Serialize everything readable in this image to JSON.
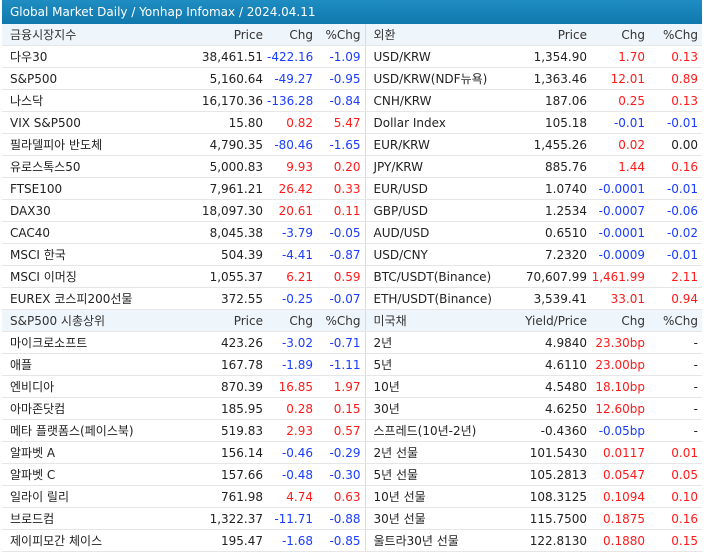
{
  "title": "Global Market Daily / Yonhap Infomax / 2024.04.11",
  "colors": {
    "up": "#ff1a1a",
    "down": "#1a3cff",
    "header_bg": "#1e88c0"
  },
  "section1": {
    "left_header": [
      "금융시장지수",
      "Price",
      "Chg",
      "%Chg"
    ],
    "right_header": [
      "외환",
      "Price",
      "Chg",
      "%Chg"
    ],
    "rows": [
      {
        "l": [
          "다우30",
          "38,461.51",
          "-422.16",
          "-1.09"
        ],
        "lc": "down",
        "r": [
          "USD/KRW",
          "1,354.90",
          "1.70",
          "0.13"
        ],
        "rc": "up"
      },
      {
        "l": [
          "S&P500",
          "5,160.64",
          "-49.27",
          "-0.95"
        ],
        "lc": "down",
        "r": [
          "USD/KRW(NDF뉴욕)",
          "1,363.46",
          "12.01",
          "0.89"
        ],
        "rc": "up"
      },
      {
        "l": [
          "나스닥",
          "16,170.36",
          "-136.28",
          "-0.84"
        ],
        "lc": "down",
        "r": [
          "CNH/KRW",
          "187.06",
          "0.25",
          "0.13"
        ],
        "rc": "up"
      },
      {
        "l": [
          "VIX S&P500",
          "15.80",
          "0.82",
          "5.47"
        ],
        "lc": "up",
        "r": [
          "Dollar Index",
          "105.18",
          "-0.01",
          "-0.01"
        ],
        "rc": "down"
      },
      {
        "l": [
          "필라델피아 반도체",
          "4,790.35",
          "-80.46",
          "-1.65"
        ],
        "lc": "down",
        "r": [
          "EUR/KRW",
          "1,455.26",
          "0.02",
          "0.00"
        ],
        "rc": "upzero"
      },
      {
        "l": [
          "유로스톡스50",
          "5,000.83",
          "9.93",
          "0.20"
        ],
        "lc": "up",
        "r": [
          "JPY/KRW",
          "885.76",
          "1.44",
          "0.16"
        ],
        "rc": "up"
      },
      {
        "l": [
          "FTSE100",
          "7,961.21",
          "26.42",
          "0.33"
        ],
        "lc": "up",
        "r": [
          "EUR/USD",
          "1.0740",
          "-0.0001",
          "-0.01"
        ],
        "rc": "down"
      },
      {
        "l": [
          "DAX30",
          "18,097.30",
          "20.61",
          "0.11"
        ],
        "lc": "up",
        "r": [
          "GBP/USD",
          "1.2534",
          "-0.0007",
          "-0.06"
        ],
        "rc": "down"
      },
      {
        "l": [
          "CAC40",
          "8,045.38",
          "-3.79",
          "-0.05"
        ],
        "lc": "down",
        "r": [
          "AUD/USD",
          "0.6510",
          "-0.0001",
          "-0.02"
        ],
        "rc": "down"
      },
      {
        "l": [
          "MSCI 한국",
          "504.39",
          "-4.41",
          "-0.87"
        ],
        "lc": "down",
        "r": [
          "USD/CNY",
          "7.2320",
          "-0.0009",
          "-0.01"
        ],
        "rc": "down"
      },
      {
        "l": [
          "MSCI 이머징",
          "1,055.37",
          "6.21",
          "0.59"
        ],
        "lc": "up",
        "r": [
          "BTC/USDT(Binance)",
          "70,607.99",
          "1,461.99",
          "2.11"
        ],
        "rc": "up"
      },
      {
        "l": [
          "EUREX 코스피200선물",
          "372.55",
          "-0.25",
          "-0.07"
        ],
        "lc": "down",
        "r": [
          "ETH/USDT(Binance)",
          "3,539.41",
          "33.01",
          "0.94"
        ],
        "rc": "up"
      }
    ]
  },
  "section2": {
    "left_header": [
      "S&P500 시총상위",
      "Price",
      "Chg",
      "%Chg"
    ],
    "right_header": [
      "미국채",
      "Yield/Price",
      "Chg",
      "%Chg"
    ],
    "rows": [
      {
        "l": [
          "마이크로소프트",
          "423.26",
          "-3.02",
          "-0.71"
        ],
        "lc": "down",
        "r": [
          "2년",
          "4.9840",
          "23.30bp",
          "-"
        ],
        "rc": "up"
      },
      {
        "l": [
          "애플",
          "167.78",
          "-1.89",
          "-1.11"
        ],
        "lc": "down",
        "r": [
          "5년",
          "4.6110",
          "23.00bp",
          "-"
        ],
        "rc": "up"
      },
      {
        "l": [
          "엔비디아",
          "870.39",
          "16.85",
          "1.97"
        ],
        "lc": "up",
        "r": [
          "10년",
          "4.5480",
          "18.10bp",
          "-"
        ],
        "rc": "up"
      },
      {
        "l": [
          "아마존닷컴",
          "185.95",
          "0.28",
          "0.15"
        ],
        "lc": "up",
        "r": [
          "30년",
          "4.6250",
          "12.60bp",
          "-"
        ],
        "rc": "up"
      },
      {
        "l": [
          "메타 플랫폼스(페이스북)",
          "519.83",
          "2.93",
          "0.57"
        ],
        "lc": "up",
        "r": [
          "스프레드(10년-2년)",
          "-0.4360",
          "-0.05bp",
          "-"
        ],
        "rc": "down"
      },
      {
        "l": [
          "알파벳 A",
          "156.14",
          "-0.46",
          "-0.29"
        ],
        "lc": "down",
        "r": [
          "2년 선물",
          "101.5430",
          "0.0117",
          "0.01"
        ],
        "rc": "up"
      },
      {
        "l": [
          "알파벳 C",
          "157.66",
          "-0.48",
          "-0.30"
        ],
        "lc": "down",
        "r": [
          "5년 선물",
          "105.2813",
          "0.0547",
          "0.05"
        ],
        "rc": "up"
      },
      {
        "l": [
          "일라이 릴리",
          "761.98",
          "4.74",
          "0.63"
        ],
        "lc": "up",
        "r": [
          "10년 선물",
          "108.3125",
          "0.1094",
          "0.10"
        ],
        "rc": "up"
      },
      {
        "l": [
          "브로드컴",
          "1,322.37",
          "-11.71",
          "-0.88"
        ],
        "lc": "down",
        "r": [
          "30년 선물",
          "115.7500",
          "0.1875",
          "0.16"
        ],
        "rc": "up"
      },
      {
        "l": [
          "제이피모간 체이스",
          "195.47",
          "-1.68",
          "-0.85"
        ],
        "lc": "down",
        "r": [
          "울트라30년 선물",
          "122.8130",
          "0.1880",
          "0.15"
        ],
        "rc": "up"
      }
    ]
  }
}
